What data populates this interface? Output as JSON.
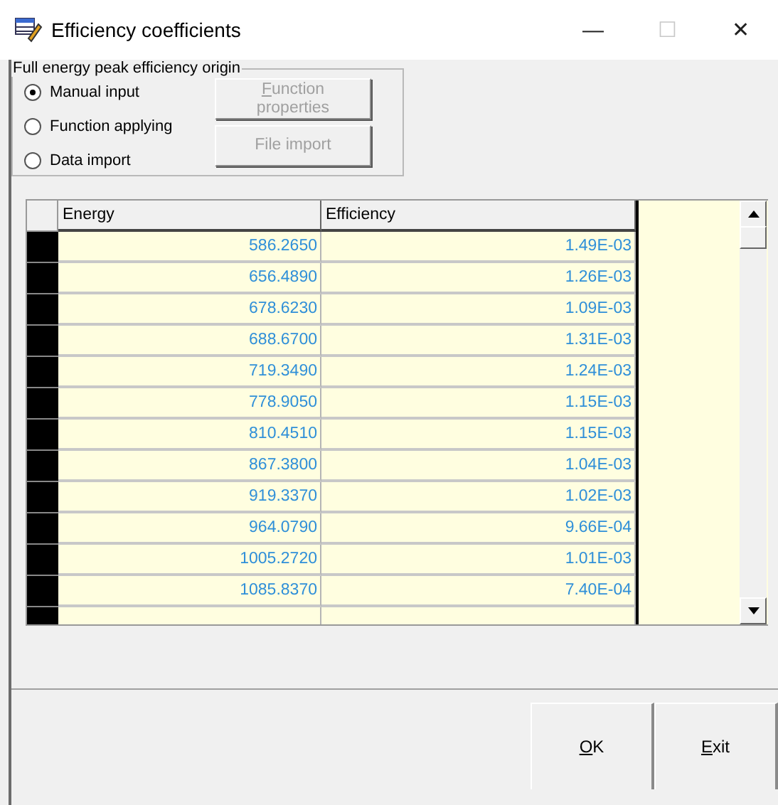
{
  "window": {
    "title": "Efficiency coefficients",
    "controls": [
      "—",
      "☐",
      "✕"
    ]
  },
  "origin": {
    "title": "Full energy peak efficiency origin",
    "options": [
      {
        "label": "Manual input",
        "selected": true
      },
      {
        "label": "Function applying",
        "selected": false
      },
      {
        "label": "Data import",
        "selected": false
      }
    ],
    "buttons": [
      {
        "label": "Function properties",
        "underline_first": true,
        "disabled": true
      },
      {
        "label": "File import",
        "underline_first": false,
        "disabled": true
      }
    ]
  },
  "table": {
    "columns": [
      "Energy",
      "Efficiency"
    ],
    "rows": [
      [
        "586.2650",
        "1.49E-03"
      ],
      [
        "656.4890",
        "1.26E-03"
      ],
      [
        "678.6230",
        "1.09E-03"
      ],
      [
        "688.6700",
        "1.31E-03"
      ],
      [
        "719.3490",
        "1.24E-03"
      ],
      [
        "778.9050",
        "1.15E-03"
      ],
      [
        "810.4510",
        "1.15E-03"
      ],
      [
        "867.3800",
        "1.04E-03"
      ],
      [
        "919.3370",
        "1.02E-03"
      ],
      [
        "964.0790",
        "9.66E-04"
      ],
      [
        "1005.2720",
        "1.01E-03"
      ],
      [
        "1085.8370",
        "7.40E-04"
      ]
    ]
  },
  "buttons": [
    {
      "label": "OK",
      "underline_first": true,
      "disabled": false
    },
    {
      "label": "Exit",
      "underline_first": true,
      "disabled": false
    }
  ]
}
